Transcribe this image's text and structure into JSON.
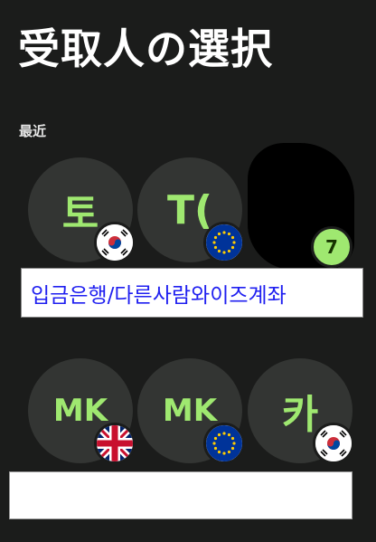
{
  "header": {
    "title": "受取人の選択"
  },
  "recent": {
    "label": "最近",
    "row1": [
      {
        "initials": "토",
        "flag": "south-korea-flag"
      },
      {
        "initials": "T(",
        "flag": "eu-flag"
      },
      {
        "initials": "",
        "flag": "wise-icon",
        "badge_text": "7"
      }
    ],
    "row2": [
      {
        "initials": "MK",
        "flag": "uk-flag"
      },
      {
        "initials": "MK",
        "flag": "eu-flag"
      },
      {
        "initials": "카",
        "flag": "south-korea-flag"
      }
    ]
  },
  "banner": {
    "text": "입금은행/다른사람와이즈계좌"
  },
  "colors": {
    "accent": "#9fe870",
    "background": "#1b1c1b",
    "circle": "#333533",
    "banner_text": "#1f1ff0"
  }
}
